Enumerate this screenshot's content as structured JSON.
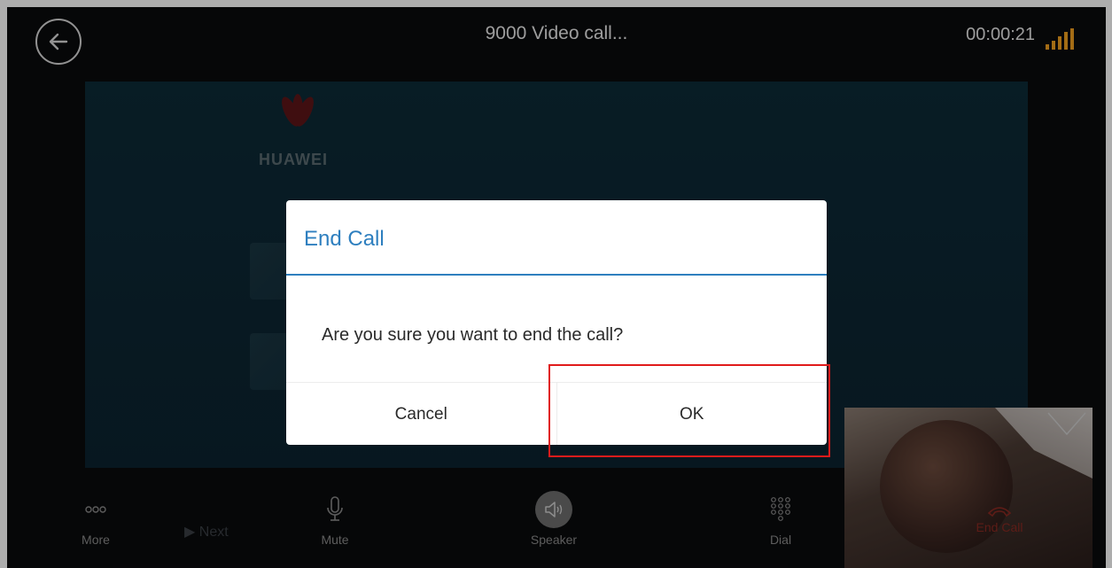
{
  "call": {
    "title": "9000  Video call...",
    "timer": "00:00:21"
  },
  "brand": {
    "logo_text": "HUAWEI"
  },
  "toolbar": {
    "more_label": "More",
    "mute_label": "Mute",
    "speaker_label": "Speaker",
    "dial_label": "Dial",
    "end_label": "End Call",
    "next_label": "Next"
  },
  "dialog": {
    "title": "End Call",
    "message": "Are you sure you want to end the call?",
    "cancel_label": "Cancel",
    "ok_label": "OK"
  },
  "colors": {
    "accent": "#2e7fbf",
    "signal": "#f0a020",
    "highlight": "#e01b1b"
  },
  "icons": {
    "back": "arrow-left-icon",
    "signal": "signal-bars-icon",
    "more": "more-dots-icon",
    "mute": "microphone-icon",
    "speaker": "speaker-icon",
    "dial": "dialpad-icon",
    "end": "hangup-icon"
  }
}
